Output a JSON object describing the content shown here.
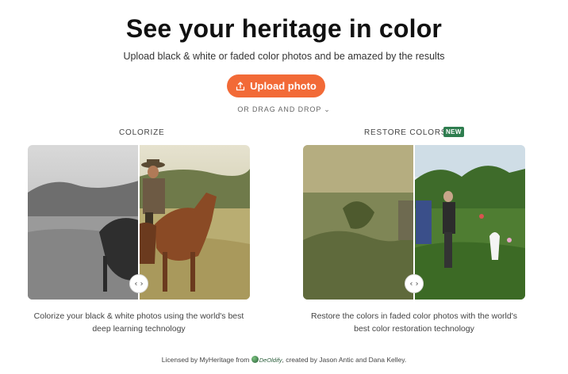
{
  "header": {
    "title": "See your heritage in color",
    "subtitle": "Upload black & white or faded color photos and be amazed by the results"
  },
  "upload": {
    "button_label": "Upload photo",
    "drag_label": "OR DRAG AND DROP"
  },
  "colorize": {
    "label": "COLORIZE",
    "caption_line1": "Colorize your black & white photos using the world's best",
    "caption_line2": "deep learning technology"
  },
  "restore": {
    "label": "RESTORE COLORS",
    "badge": "NEW",
    "caption_line1": "Restore the colors in faded color photos with the world's",
    "caption_line2": "best color restoration technology"
  },
  "slider": {
    "handle_glyph": "‹ ›"
  },
  "footer": {
    "prefix": "Licensed by MyHeritage from",
    "logo": "DeOldify",
    "suffix": ", created by Jason Antic and Dana Kelley."
  },
  "colors": {
    "accent": "#f26a37",
    "badge": "#2e7d4f"
  }
}
